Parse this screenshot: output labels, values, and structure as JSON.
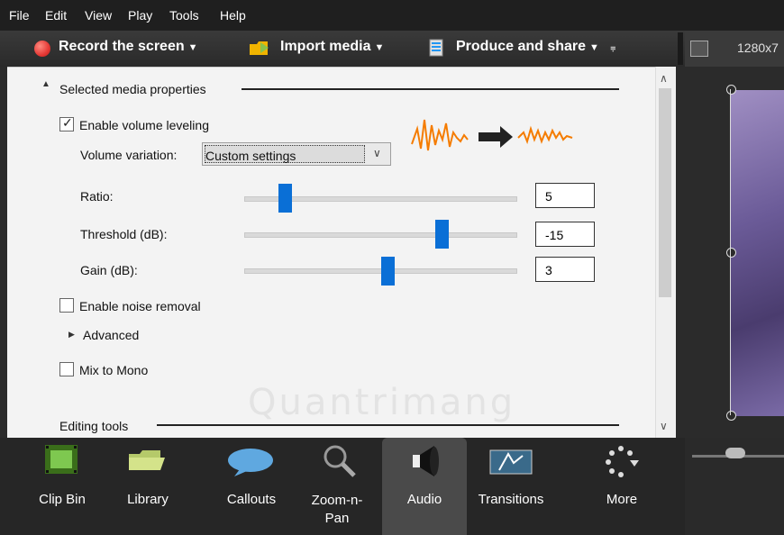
{
  "menubar": {
    "items": [
      "File",
      "Edit",
      "View",
      "Play",
      "Tools",
      "Help"
    ]
  },
  "toolbar": {
    "record_label": "Record the screen",
    "import_label": "Import media",
    "produce_label": "Produce and share",
    "dimensions": "1280x7"
  },
  "panel": {
    "section_title": "Selected media properties",
    "enable_volume_leveling": {
      "label": "Enable volume leveling",
      "checked": true
    },
    "volume_variation": {
      "label": "Volume variation:",
      "value": "Custom settings"
    },
    "sliders": [
      {
        "label": "Ratio:",
        "value": "5",
        "level": 0.15
      },
      {
        "label": "Threshold (dB):",
        "value": "-15",
        "level": 0.73
      },
      {
        "label": "Gain (dB):",
        "value": "3",
        "level": 0.53
      }
    ],
    "enable_noise_removal": {
      "label": "Enable noise removal",
      "checked": false
    },
    "advanced_label": "Advanced",
    "mix_to_mono": {
      "label": "Mix to Mono",
      "checked": false
    },
    "editing_tools_label": "Editing tools"
  },
  "tabs": [
    {
      "label": "Clip Bin",
      "icon": "film-icon"
    },
    {
      "label": "Library",
      "icon": "folder-icon"
    },
    {
      "label": "Callouts",
      "icon": "speech-bubble-icon"
    },
    {
      "label": "Zoom-n-Pan",
      "icon": "magnifier-icon"
    },
    {
      "label": "Audio",
      "icon": "speaker-icon",
      "active": true
    },
    {
      "label": "Transitions",
      "icon": "transition-icon"
    },
    {
      "label": "More",
      "icon": "more-icon"
    }
  ],
  "watermark": "Quantrimang",
  "colors": {
    "slider_thumb": "#0a6fd6",
    "record": "#e53935",
    "active_tab": "#4a4a4a"
  }
}
